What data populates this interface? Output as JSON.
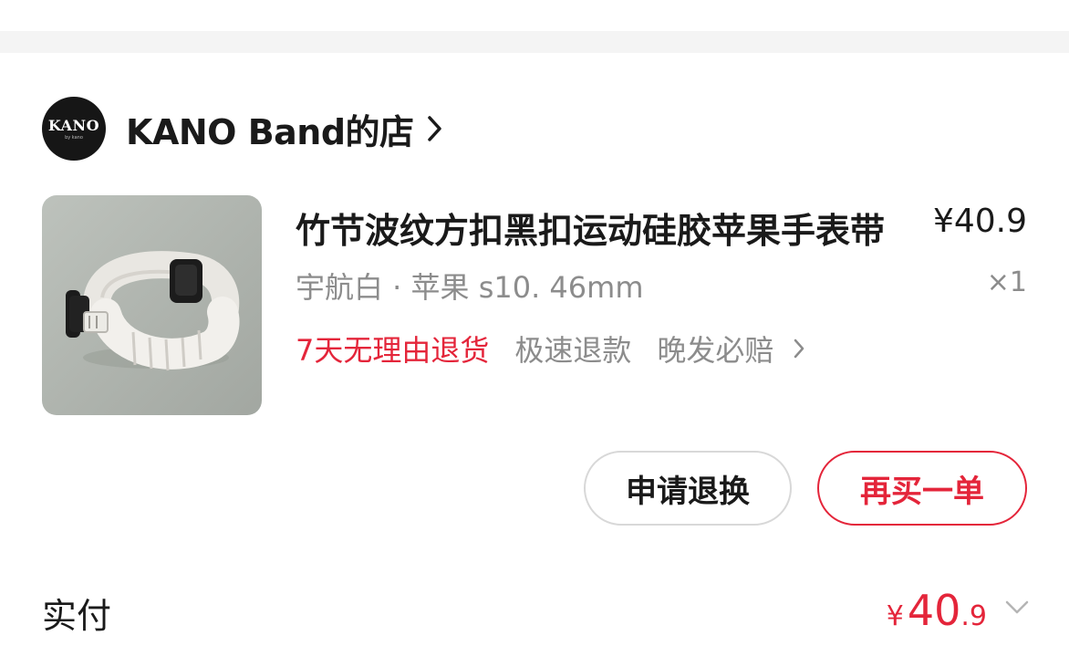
{
  "shop": {
    "logo_text": "KANO",
    "logo_sub": "by kano",
    "name": "KANO Band的店"
  },
  "item": {
    "title": "竹节波纹方扣黑扣运动硅胶苹果手表带",
    "price": "¥40.9",
    "spec": "宇航白 · 苹果 s10. 46mm",
    "quantity": "×1",
    "image_icon": "white-watch-band-photo"
  },
  "services": {
    "return_policy": "7天无理由退货",
    "fast_refund": "极速退款",
    "late_delivery": "晚发必赔"
  },
  "actions": {
    "refund_label": "申请退换",
    "rebuy_label": "再买一单"
  },
  "payment": {
    "label": "实付",
    "currency": "¥",
    "amount_int": "40",
    "amount_dec": ".9"
  },
  "colors": {
    "accent": "#e4253a",
    "text": "#1a1a1a",
    "muted": "#8c8c8c"
  }
}
